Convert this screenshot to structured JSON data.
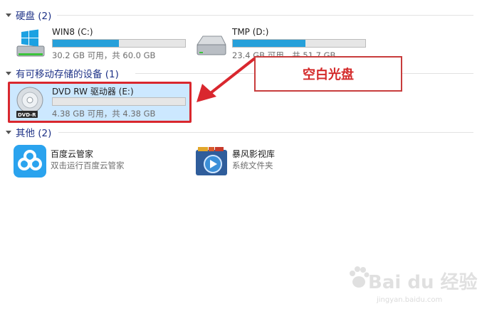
{
  "groups": {
    "hard_disks": {
      "label": "硬盘 (2)"
    },
    "removable": {
      "label": "有可移动存储的设备 (1)"
    },
    "other": {
      "label": "其他 (2)"
    }
  },
  "drives": [
    {
      "name": "WIN8 (C:)",
      "capacity": "30.2 GB 可用，共 60.0 GB",
      "used_fraction": 0.5,
      "icon": "windows-drive-icon"
    },
    {
      "name": "TMP (D:)",
      "capacity": "23.4 GB 可用，共 51.7 GB",
      "used_fraction": 0.55,
      "icon": "hard-drive-icon"
    }
  ],
  "removable_drives": [
    {
      "name": "DVD RW 驱动器 (E:)",
      "capacity": "4.38 GB 可用，共 4.38 GB",
      "used_fraction": 0.0,
      "icon": "dvd-rw-icon",
      "disc_label": "DVD-R"
    }
  ],
  "others": [
    {
      "name": "百度云管家",
      "subtitle": "双击运行百度云管家",
      "icon": "baidu-cloud-icon"
    },
    {
      "name": "暴风影视库",
      "subtitle": "系统文件夹",
      "icon": "media-library-folder-icon"
    }
  ],
  "annotation": {
    "callout_text": "空白光盘",
    "color": "#d42a2a"
  },
  "watermark": {
    "text": "Bai du 经验",
    "url": "jingyan.baidu.com"
  },
  "colors": {
    "accent": "#26a0da",
    "header": "#1e3287",
    "selection": "#cce8ff"
  }
}
